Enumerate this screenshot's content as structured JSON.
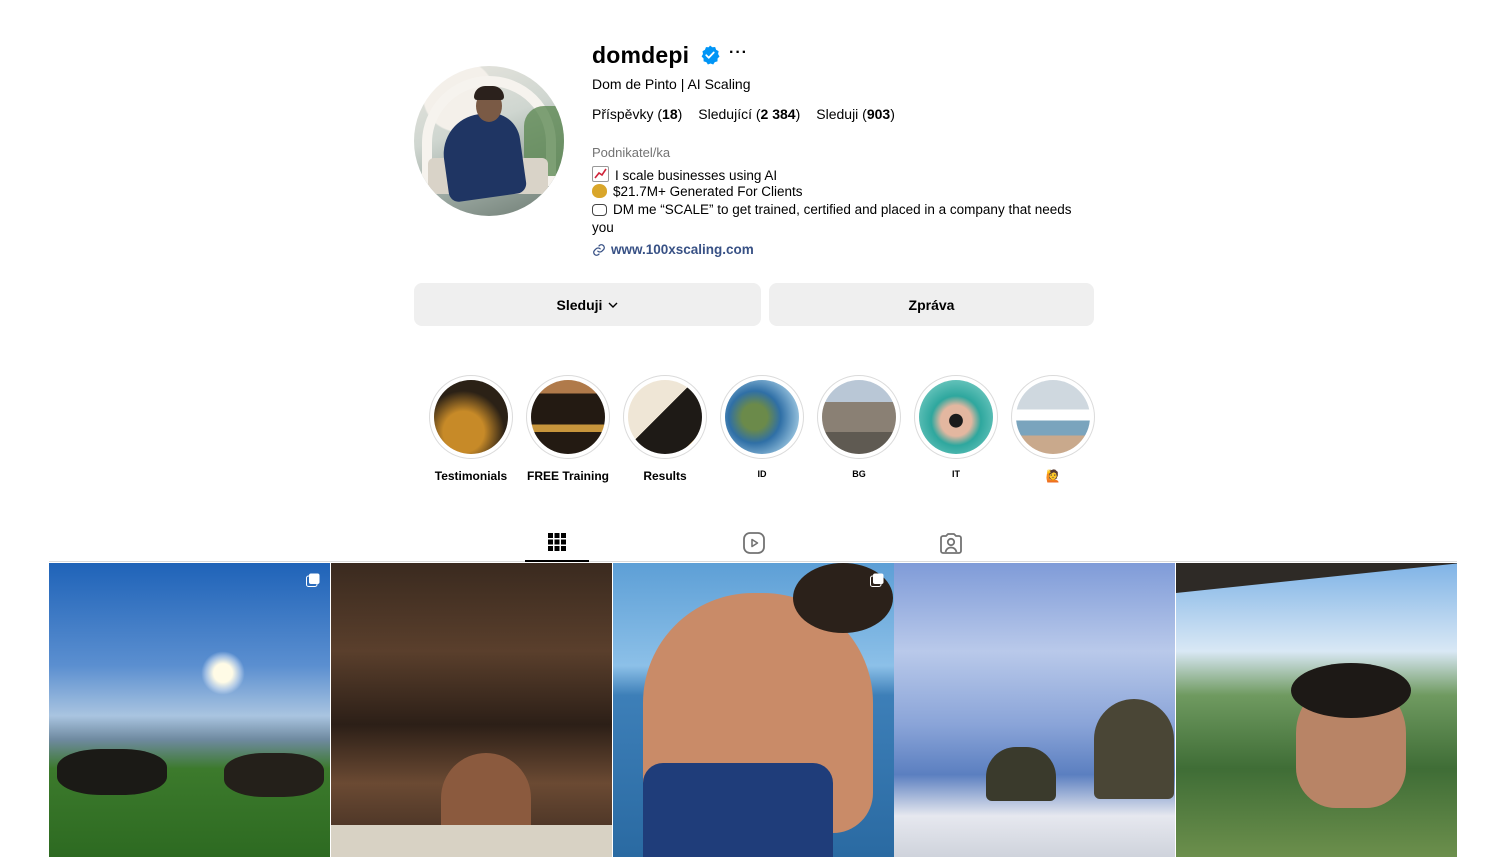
{
  "profile": {
    "username": "domdepi",
    "full_name": "Dom de Pinto | AI Scaling",
    "more_label": "···",
    "stats": {
      "posts_label": "Příspěvky",
      "posts_value": "18",
      "followers_label": "Sledující",
      "followers_value": "2 384",
      "following_label": "Sleduji",
      "following_value": "903"
    },
    "category": "Podnikatel/ka",
    "bio": [
      {
        "icon": "chart-increasing-icon",
        "text": "I scale businesses using AI"
      },
      {
        "icon": "money-bag-icon",
        "text": "$21.7M+ Generated For Clients"
      },
      {
        "icon": "speech-balloon-icon",
        "text": "DM me “SCALE” to get trained, certified and placed in a company that needs"
      },
      {
        "icon": "",
        "text": "you"
      }
    ],
    "link": "www.100xscaling.com"
  },
  "actions": {
    "follow_label": "Sleduji",
    "message_label": "Zpráva"
  },
  "highlights": [
    {
      "label": "Testimonials"
    },
    {
      "label": "FREE Training"
    },
    {
      "label": "Results"
    },
    {
      "label": "ID"
    },
    {
      "label": "BG"
    },
    {
      "label": "IT"
    },
    {
      "label": "🙋"
    }
  ],
  "tabs": [
    {
      "icon": "grid-icon",
      "active": true
    },
    {
      "icon": "reels-icon",
      "active": false
    },
    {
      "icon": "tagged-icon",
      "active": false
    }
  ],
  "colors": {
    "verified": "#0095f6",
    "link": "#385185",
    "button_bg": "#efefef",
    "muted_text": "#737373"
  }
}
